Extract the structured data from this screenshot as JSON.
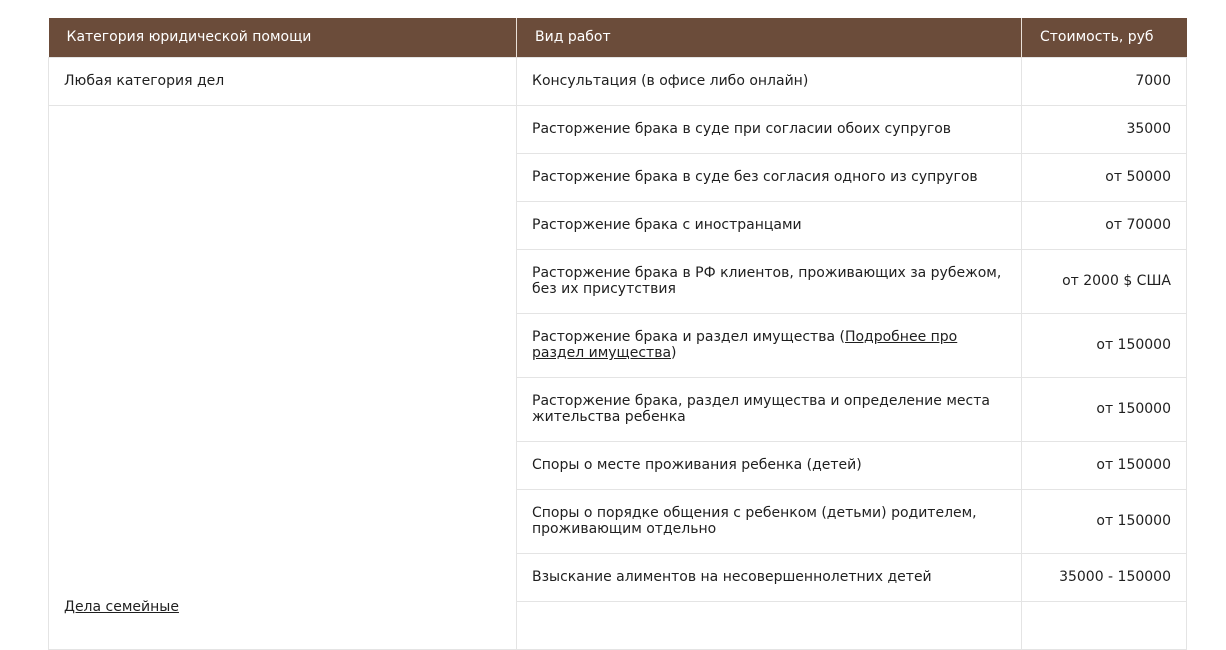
{
  "table": {
    "headers": {
      "category": "Категория юридической помощи",
      "work": "Вид работ",
      "price": "Стоимость, руб"
    },
    "first_row": {
      "category": "Любая категория дел",
      "work": "Консультация (в офисе либо онлайн)",
      "price": "7000"
    },
    "family_category_label": "Дела семейные",
    "family_rows": [
      {
        "work": "Расторжение брака в суде при согласии обоих супругов",
        "price": "35000"
      },
      {
        "work": "Расторжение брака в суде без согласия одного из супругов",
        "price": "от 50000"
      },
      {
        "work": "Расторжение брака с иностранцами",
        "price": "от 70000"
      },
      {
        "work": "Расторжение брака в РФ клиентов, проживающих за рубежом, без их присутствия",
        "price": "от 2000 $ США"
      },
      {
        "work_prefix": "Расторжение брака и раздел имущества (",
        "work_link": "Подробнее про раздел имущества",
        "work_suffix": ")",
        "price": "от 150000"
      },
      {
        "work": "Расторжение брака, раздел имущества и определение места жительства ребенка",
        "price": "от 150000"
      },
      {
        "work": "Споры о месте проживания ребенка (детей)",
        "price": "от 150000"
      },
      {
        "work": "Споры о порядке общения с ребенком (детьми) родителем, проживающим отдельно",
        "price": "от 150000"
      },
      {
        "work": "Взыскание алиментов на несовершеннолетних детей",
        "price": "35000 - 150000"
      }
    ]
  },
  "colors": {
    "header_bg": "#6b4c3a",
    "header_text": "#ffffff",
    "border": "#e4e4e4"
  }
}
